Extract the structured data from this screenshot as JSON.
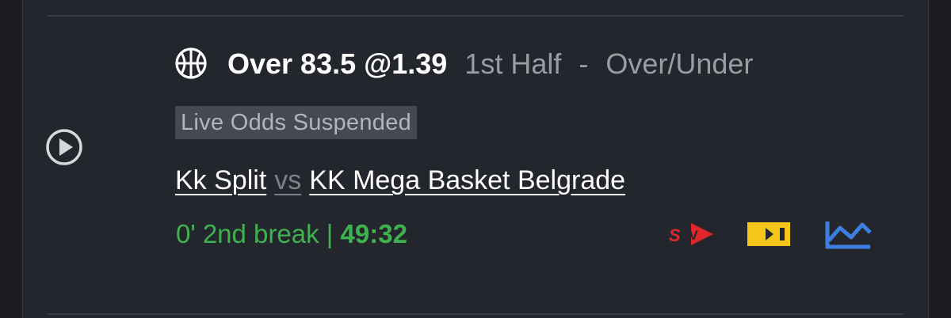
{
  "bet": {
    "selection": "Over 83.5 @1.39",
    "period": "1st Half",
    "separator": "-",
    "market": "Over/Under"
  },
  "badge": {
    "suspended": "Live Odds Suspended"
  },
  "match": {
    "home": "Kk Split",
    "vs": "vs",
    "away": "KK Mega Basket Belgrade"
  },
  "status": {
    "phase": "0' 2nd break",
    "divider": "|",
    "clock": "49:32"
  },
  "icons": {
    "sport": "basketball-icon",
    "play": "play-circle-icon",
    "stream": "stv-stream-icon",
    "video": "video-player-icon",
    "stats": "line-chart-icon"
  },
  "colors": {
    "background": "#24262d",
    "live_green": "#3fb24f",
    "stv_red": "#e0282c",
    "video_yellow": "#f5c518",
    "stats_blue": "#3d7fe0",
    "muted_text": "#9a9ca3"
  }
}
